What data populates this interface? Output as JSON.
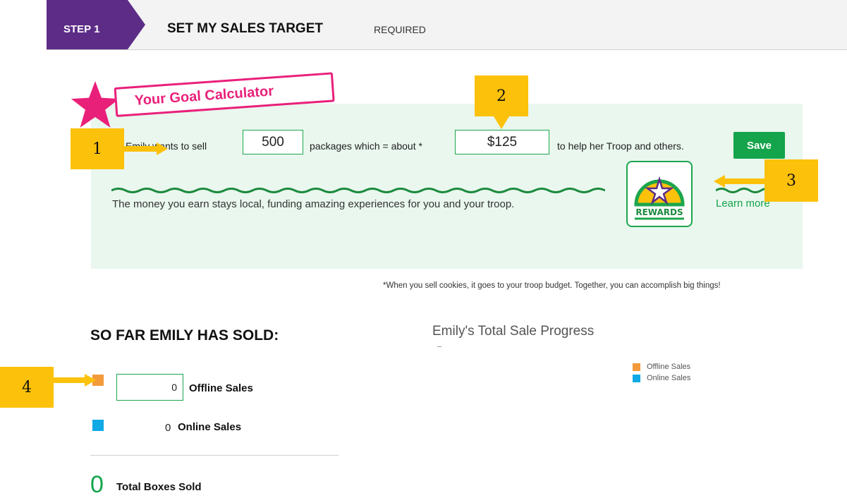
{
  "step": {
    "badge": "STEP 1",
    "title": "SET MY SALES TARGET",
    "required": "REQUIRED"
  },
  "calculator": {
    "banner": "Your Goal Calculator",
    "pre_text": "Emily wants to sell",
    "packages_value": "500",
    "mid_text": "packages which = about *",
    "dollar_value": "$125",
    "post_text": "to help her Troop and others.",
    "save_label": "Save",
    "money_text": "The money you earn stays local, funding amazing experiences for you and your troop.",
    "rewards_label": "REWARDS",
    "learn_more": "Learn more"
  },
  "footnote": "*When you sell cookies, it goes to your troop budget. Together, you can accomplish big things!",
  "sales": {
    "heading": "SO FAR EMILY HAS SOLD:",
    "offline_value": "0",
    "offline_label": "Offline Sales",
    "online_value": "0",
    "online_label": "Online Sales",
    "total_value": "0",
    "total_label": "Total Boxes Sold"
  },
  "chart": {
    "title": "Emily's Total Sale Progress",
    "legend": [
      {
        "label": "Offline Sales",
        "color": "#f39a3b"
      },
      {
        "label": "Online Sales",
        "color": "#0fa9e6"
      }
    ]
  },
  "callouts": [
    "1",
    "2",
    "3",
    "4"
  ],
  "colors": {
    "step_badge": "#5c2c87",
    "brand_green": "#14a44b",
    "banner_pink": "#e9207a",
    "panel_bg": "#e9f7ee",
    "callout_yellow": "#fcc10a"
  }
}
